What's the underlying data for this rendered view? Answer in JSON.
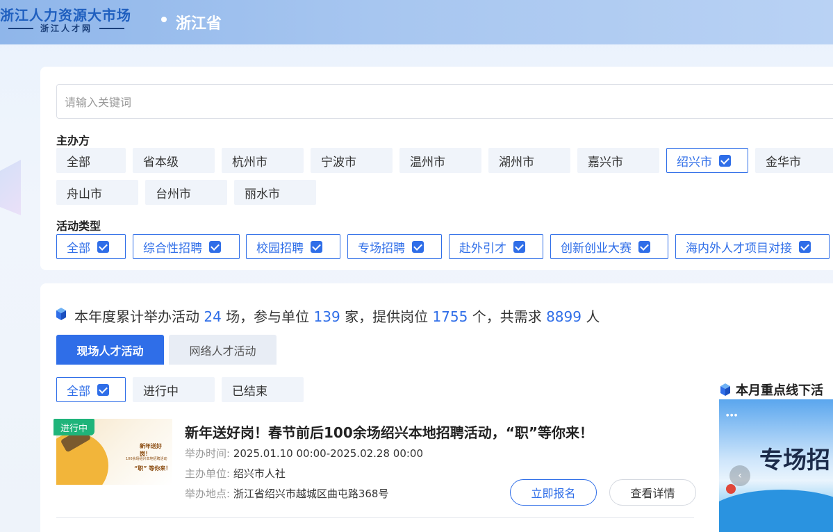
{
  "header": {
    "logo_title": "浙江人力资源大市场",
    "logo_subtitle": "浙江人才网",
    "region": "浙江省"
  },
  "search": {
    "placeholder": "请输入关键词"
  },
  "organizer": {
    "label": "主办方",
    "options": [
      "全部",
      "省本级",
      "杭州市",
      "宁波市",
      "温州市",
      "湖州市",
      "嘉兴市",
      "绍兴市",
      "金华市",
      "舟山市",
      "台州市",
      "丽水市"
    ],
    "selected": "绍兴市"
  },
  "activity_type": {
    "label": "活动类型",
    "options": [
      "全部",
      "综合性招聘",
      "校园招聘",
      "专场招聘",
      "赴外引才",
      "创新创业大赛",
      "海内外人才项目对接"
    ],
    "all_checked": true
  },
  "stats": {
    "prefix": "本年度累计举办活动",
    "activities": "24",
    "unit1": "场，参与单位",
    "units": "139",
    "unit2": "家，提供岗位",
    "positions": "1755",
    "unit3": "个，共需求",
    "demand": "8899",
    "unit4": "人"
  },
  "tabs": [
    "现场人才活动",
    "网络人才活动"
  ],
  "active_tab": "现场人才活动",
  "status_filter": {
    "options": [
      "全部",
      "进行中",
      "已结束"
    ],
    "selected": "全部"
  },
  "events": [
    {
      "badge": "进行中",
      "title": "新年送好岗！春节前后100余场绍兴本地招聘活动，“职”等你来！",
      "time_label": "举办时间:",
      "time": "2025.01.10 00:00-2025.02.28 00:00",
      "host_label": "主办单位:",
      "host": "绍兴市人社",
      "place_label": "举办地点:",
      "place": "浙江省绍兴市越城区曲屯路368号",
      "register_label": "立即报名",
      "detail_label": "查看详情",
      "thumb_line1": "新年送好岗！",
      "thumb_line2": "100余场绍兴本地招聘活动",
      "thumb_line3": "“职” 等你来！"
    }
  ],
  "sidebar": {
    "title": "本月重点线下活",
    "banner_text": "专场招"
  },
  "colors": {
    "accent": "#2f6ee8",
    "badge": "#1fb47a"
  }
}
